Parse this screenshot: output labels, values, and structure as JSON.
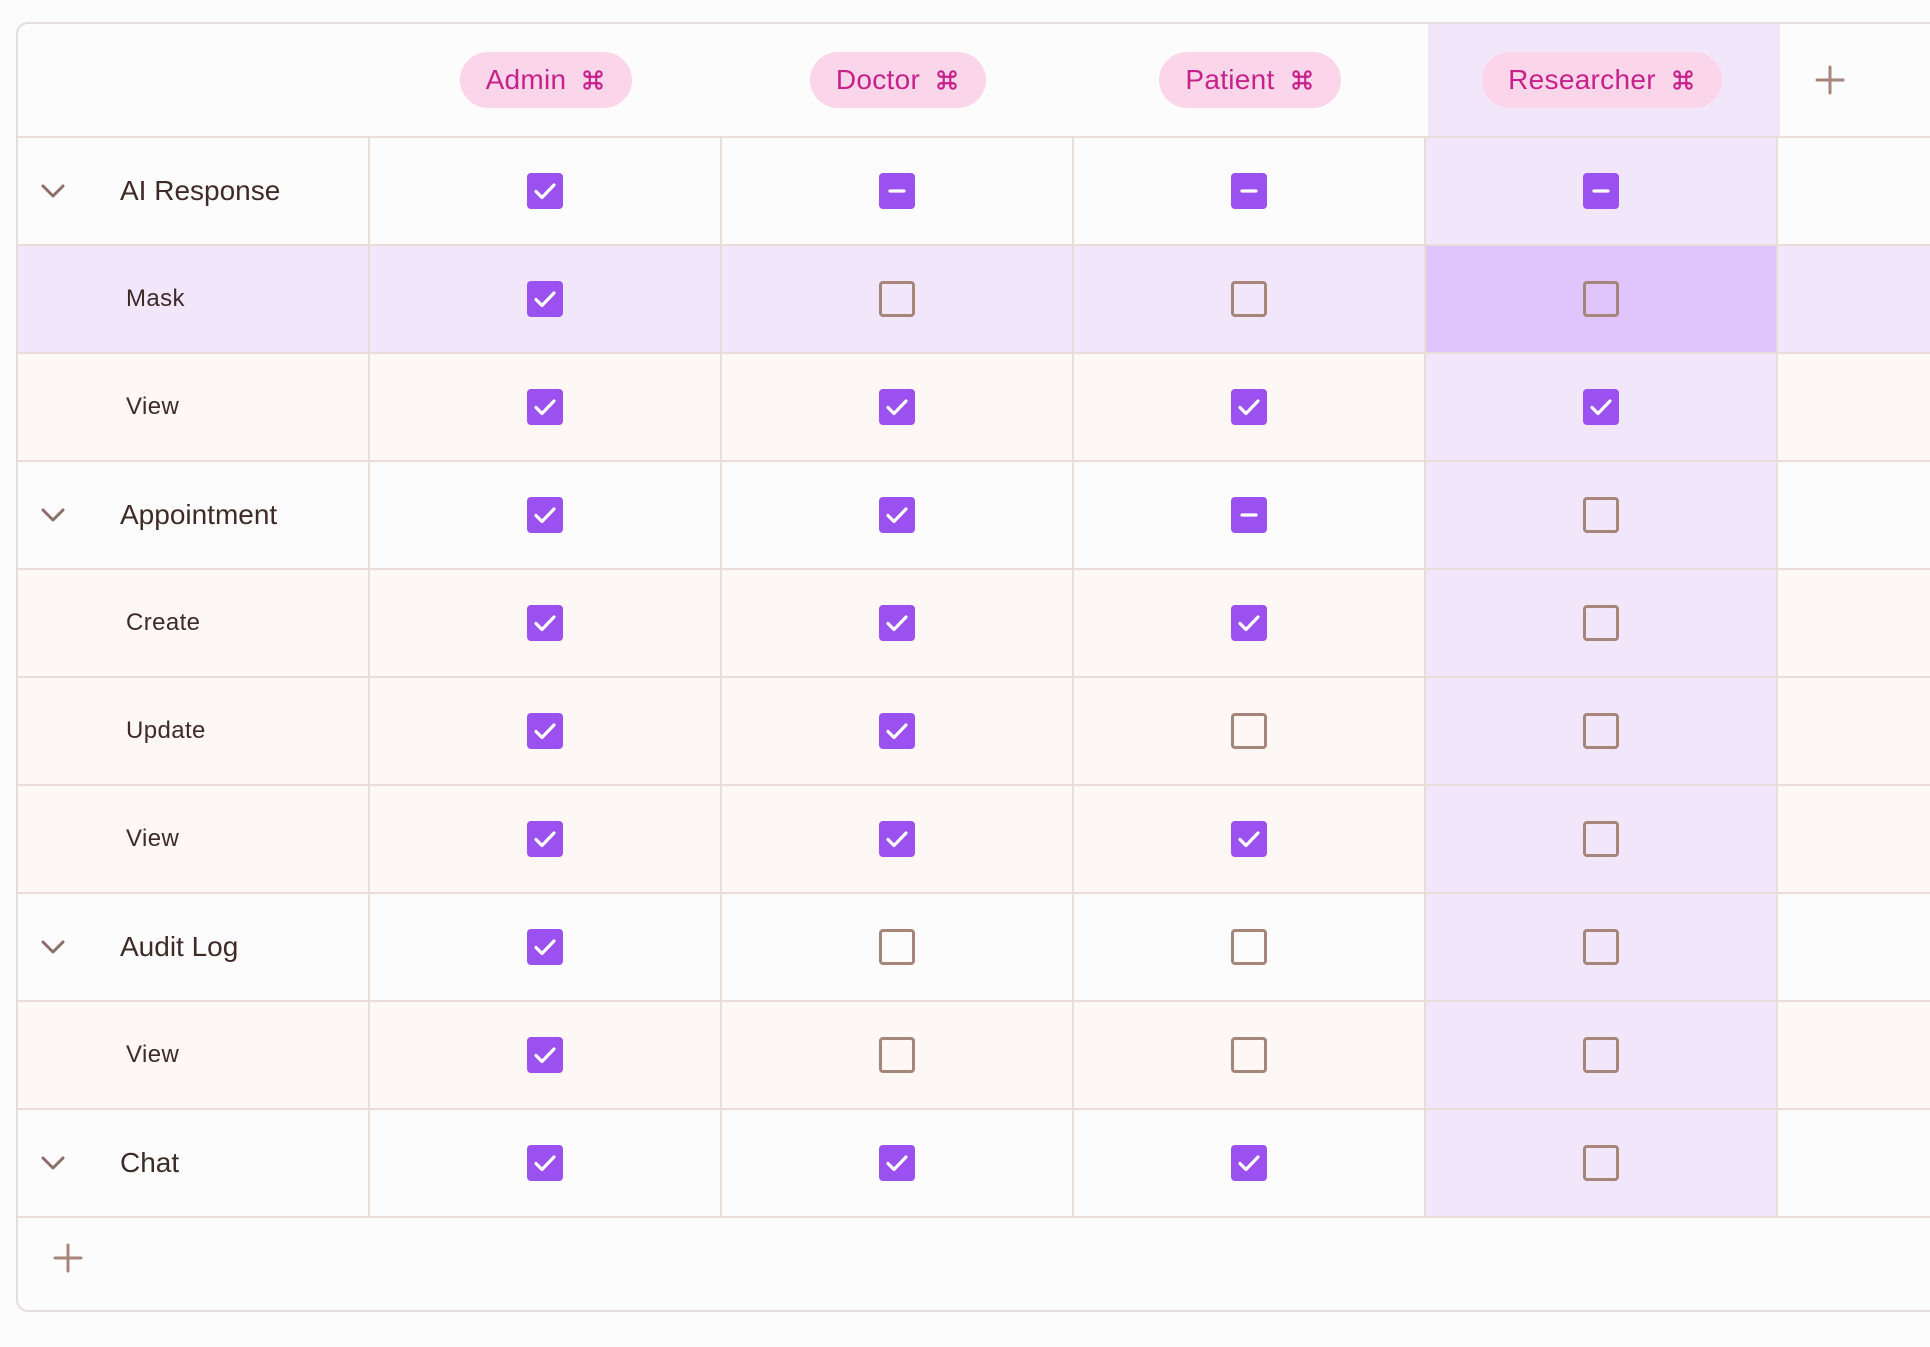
{
  "roles": [
    "Admin",
    "Doctor",
    "Patient",
    "Researcher"
  ],
  "selected_role": "Researcher",
  "colors": {
    "accent": "#9b51f0",
    "pill_bg": "#fbd6ea",
    "pill_text": "#c8218a",
    "highlight": "#f2e6fb",
    "highlight_strong": "#dfc5fb",
    "unchecked_border": "#a6857a"
  },
  "rows": [
    {
      "label": "AI Response",
      "type": "group",
      "states": [
        "checked",
        "mixed",
        "mixed",
        "mixed"
      ]
    },
    {
      "label": "Mask",
      "type": "child",
      "selected": true,
      "states": [
        "checked",
        "unchecked",
        "unchecked",
        "unchecked"
      ]
    },
    {
      "label": "View",
      "type": "child",
      "states": [
        "checked",
        "checked",
        "checked",
        "checked"
      ]
    },
    {
      "label": "Appointment",
      "type": "group",
      "states": [
        "checked",
        "checked",
        "mixed",
        "unchecked"
      ]
    },
    {
      "label": "Create",
      "type": "child",
      "states": [
        "checked",
        "checked",
        "checked",
        "unchecked"
      ]
    },
    {
      "label": "Update",
      "type": "child",
      "states": [
        "checked",
        "checked",
        "unchecked",
        "unchecked"
      ]
    },
    {
      "label": "View",
      "type": "child",
      "states": [
        "checked",
        "checked",
        "checked",
        "unchecked"
      ]
    },
    {
      "label": "Audit Log",
      "type": "group",
      "states": [
        "checked",
        "unchecked",
        "unchecked",
        "unchecked"
      ]
    },
    {
      "label": "View",
      "type": "child",
      "states": [
        "checked",
        "unchecked",
        "unchecked",
        "unchecked"
      ]
    },
    {
      "label": "Chat",
      "type": "group",
      "states": [
        "checked",
        "checked",
        "checked",
        "unchecked"
      ]
    }
  ],
  "icons": {
    "role_pill": "command-icon",
    "add_role": "plus-icon",
    "add_permission": "plus-icon",
    "group_toggle": "chevron-down-icon",
    "checked": "checkmark-icon",
    "mixed": "minus-icon"
  }
}
